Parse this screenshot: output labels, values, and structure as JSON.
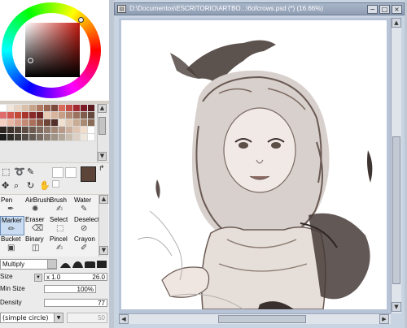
{
  "document": {
    "title": "D:\\Documentos\\ESCRITORIO\\ARTBO...\\6ofcrows.psd (*) (16.66%)",
    "app_icon": "document-icon",
    "buttons": {
      "minimize": "−",
      "maximize": "□",
      "close": "×"
    }
  },
  "color_wheel": {
    "current_color": "#5c4438",
    "sub_color": "#ffffff",
    "hue_color": "#c61a10"
  },
  "swatches": [
    "#ffffff",
    "#f2e6da",
    "#e8d4c4",
    "#d9bfa8",
    "#c7a38a",
    "#b07a62",
    "#9a6550",
    "#7c4a3a",
    "#d86a5a",
    "#c44a44",
    "#a12a30",
    "#7b1c24",
    "#5a1a1e",
    "#e06d6d",
    "#d2554f",
    "#c44a3a",
    "#a8342c",
    "#8a2a28",
    "#6e2222",
    "#e7c9b4",
    "#d9b49c",
    "#c79e86",
    "#b28872",
    "#9a725e",
    "#805c4c",
    "#664a3e",
    "#f4d0c0",
    "#e8b8a4",
    "#d8a08c",
    "#c48a74",
    "#aa705c",
    "#8e5a48",
    "#6e4436",
    "#503028",
    "#f0e0d0",
    "#e0c8b4",
    "#c8ac94",
    "#a88a74",
    "#886a56",
    "#2c2420",
    "#3c302a",
    "#4c3e36",
    "#5c4c42",
    "#6c5a50",
    "#7e6a5e",
    "#90786a",
    "#a48878",
    "#b89a88",
    "#ccae9c",
    "#e0c4b2",
    "#f2dccc",
    "#ffffff",
    "#1c1c1c",
    "#2e2a28",
    "#403a36",
    "#524a44",
    "#645a52",
    "#786c62",
    "#8c7e72",
    "#a09284",
    "#b4a698",
    "#c8bcae",
    "#dcd0c4",
    "#eee6dc",
    "#ffffff"
  ],
  "tools": [
    "selection-rect-icon",
    "lasso-icon",
    "magic-wand-icon",
    "move-icon",
    "zoom-icon",
    "rotate-icon",
    "hand-icon"
  ],
  "brushes": [
    {
      "label": "Pen",
      "icon": "pen-icon"
    },
    {
      "label": "AirBrush",
      "icon": "airbrush-icon"
    },
    {
      "label": "Brush",
      "icon": "brush-icon"
    },
    {
      "label": "Water",
      "icon": "water-icon"
    },
    {
      "label": "Marker",
      "icon": "marker-icon"
    },
    {
      "label": "Eraser",
      "icon": "eraser-icon"
    },
    {
      "label": "Select",
      "icon": "select-brush-icon"
    },
    {
      "label": "Deselect",
      "icon": "deselect-icon"
    },
    {
      "label": "Bucket",
      "icon": "bucket-icon"
    },
    {
      "label": "Binary",
      "icon": "binary-icon"
    },
    {
      "label": "Pincel",
      "icon": "pincel-icon"
    },
    {
      "label": "Crayon",
      "icon": "crayon-icon"
    }
  ],
  "selected_brush": "Marker",
  "blend_mode": "Multiply",
  "props": {
    "size_label": "Size",
    "size_multiplier": "x 1.0",
    "size_value": "26.0",
    "min_size_label": "Min Size",
    "min_size_value": "100%",
    "density_label": "Density",
    "density_value": "77",
    "shape_label": "(simple circle)",
    "shape_value": "50"
  }
}
